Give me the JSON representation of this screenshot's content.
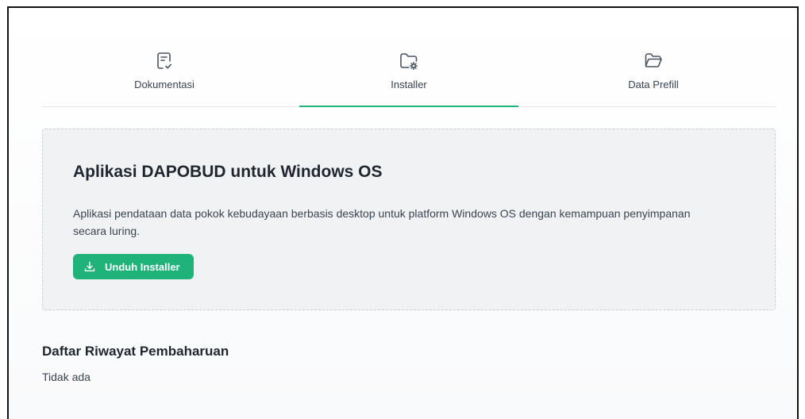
{
  "tabs": [
    {
      "label": "Dokumentasi",
      "icon": "document-check-icon",
      "active": false
    },
    {
      "label": "Installer",
      "icon": "folder-gear-icon",
      "active": true
    },
    {
      "label": "Data Prefill",
      "icon": "folder-open-icon",
      "active": false
    }
  ],
  "installer_card": {
    "title": "Aplikasi DAPOBUD untuk Windows OS",
    "description": "Aplikasi pendataan data pokok kebudayaan berbasis desktop untuk platform Windows OS dengan kemampuan penyimpanan secara luring.",
    "download_button_label": "Unduh Installer",
    "download_icon": "download-icon"
  },
  "history": {
    "title": "Daftar Riwayat Pembaharuan",
    "empty_text": "Tidak ada"
  },
  "colors": {
    "accent": "#1fb37a",
    "card_background": "#f1f2f4",
    "text_dark": "#1f262e"
  }
}
